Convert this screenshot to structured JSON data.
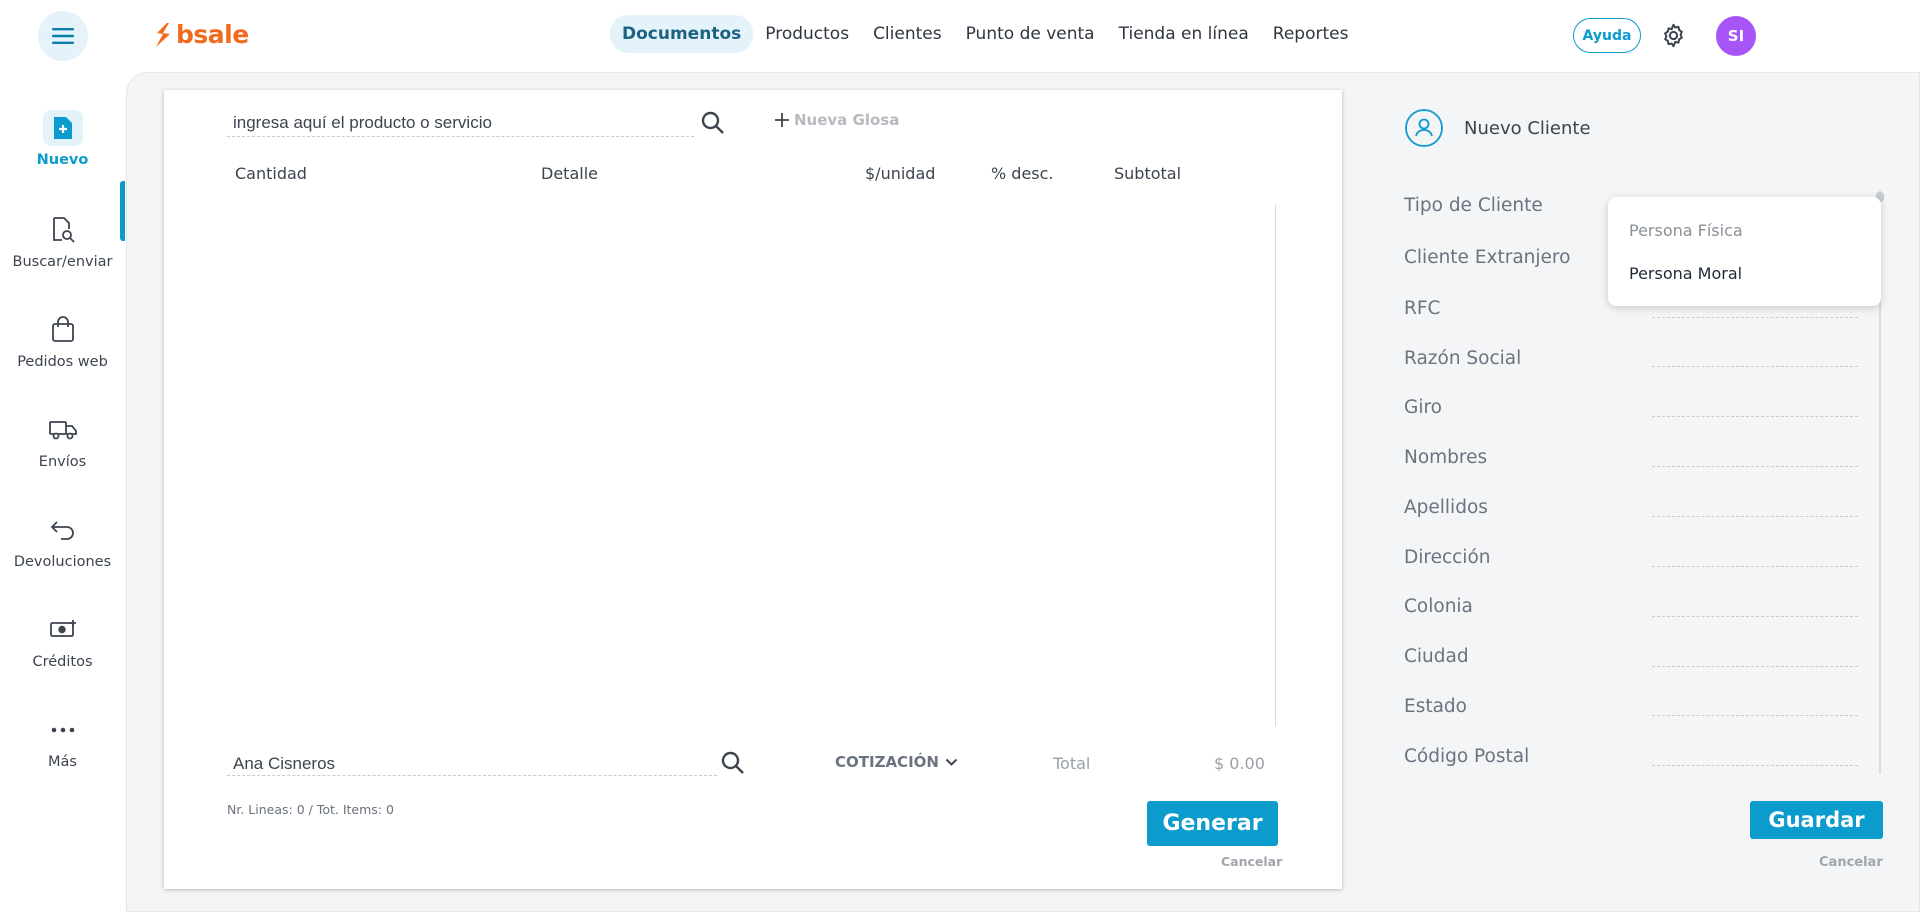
{
  "brand": {
    "name": "bsale",
    "color": "#f26a1b",
    "accent": "#0b9bcc"
  },
  "topnav": {
    "items": [
      {
        "label": "Documentos",
        "active": true
      },
      {
        "label": "Productos"
      },
      {
        "label": "Clientes"
      },
      {
        "label": "Punto de venta"
      },
      {
        "label": "Tienda en línea"
      },
      {
        "label": "Reportes"
      }
    ],
    "help_label": "Ayuda",
    "avatar_initials": "SI"
  },
  "sidebar": {
    "items": [
      {
        "label": "Nuevo",
        "icon": "new-document-icon",
        "active": true
      },
      {
        "label": "Buscar/enviar",
        "icon": "search-document-icon"
      },
      {
        "label": "Pedidos web",
        "icon": "shopping-bag-icon"
      },
      {
        "label": "Envíos",
        "icon": "truck-icon"
      },
      {
        "label": "Devoluciones",
        "icon": "return-arrow-icon"
      },
      {
        "label": "Créditos",
        "icon": "cash-icon"
      },
      {
        "label": "Más",
        "icon": "more-dots-icon"
      }
    ]
  },
  "document": {
    "search_placeholder": "ingresa aquí el producto o servicio",
    "nueva_glosa": "Nueva Glosa",
    "columns": [
      "Cantidad",
      "Detalle",
      "$/unidad",
      "% desc.",
      "Subtotal"
    ],
    "client_value": "Ana Cisneros",
    "doc_type": "COTIZACIÓN",
    "total_label": "Total",
    "total_value": "$ 0.00",
    "lines_info": "Nr. Lineas: 0 / Tot. Items: 0",
    "generate_label": "Generar",
    "cancel_label": "Cancelar"
  },
  "client_panel": {
    "title": "Nuevo Cliente",
    "fields": [
      "Tipo de Cliente",
      "Cliente Extranjero",
      "RFC",
      "Razón Social",
      "Giro",
      "Nombres",
      "Apellidos",
      "Dirección",
      "Colonia",
      "Ciudad",
      "Estado",
      "Código Postal"
    ],
    "dropdown_options": [
      "Persona Física",
      "Persona Moral"
    ],
    "save_label": "Guardar",
    "cancel_label": "Cancelar"
  }
}
